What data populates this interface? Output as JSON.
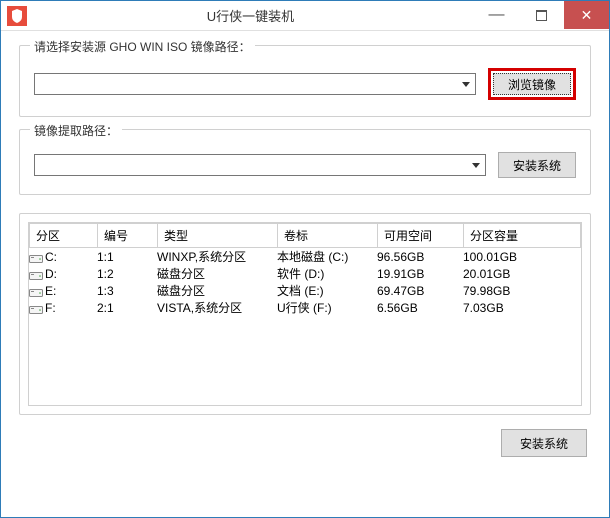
{
  "window": {
    "title": "U行侠一键装机"
  },
  "group_source": {
    "title": "请选择安装源 GHO WIN ISO 镜像路径：",
    "browse_label": "浏览镜像"
  },
  "group_extract": {
    "title": "镜像提取路径：",
    "install_label": "安装系统"
  },
  "table": {
    "headers": {
      "partition": "分区",
      "number": "编号",
      "type": "类型",
      "label": "卷标",
      "free": "可用空间",
      "capacity": "分区容量"
    },
    "rows": [
      {
        "partition": "C:",
        "number": "1:1",
        "type": "WINXP,系统分区",
        "label": "本地磁盘 (C:)",
        "free": "96.56GB",
        "capacity": "100.01GB"
      },
      {
        "partition": "D:",
        "number": "1:2",
        "type": "磁盘分区",
        "label": "软件 (D:)",
        "free": "19.91GB",
        "capacity": "20.01GB"
      },
      {
        "partition": "E:",
        "number": "1:3",
        "type": "磁盘分区",
        "label": "文档 (E:)",
        "free": "69.47GB",
        "capacity": "79.98GB"
      },
      {
        "partition": "F:",
        "number": "2:1",
        "type": "VISTA,系统分区",
        "label": "U行侠 (F:)",
        "free": "6.56GB",
        "capacity": "7.03GB"
      }
    ]
  },
  "footer": {
    "install_label": "安装系统"
  }
}
